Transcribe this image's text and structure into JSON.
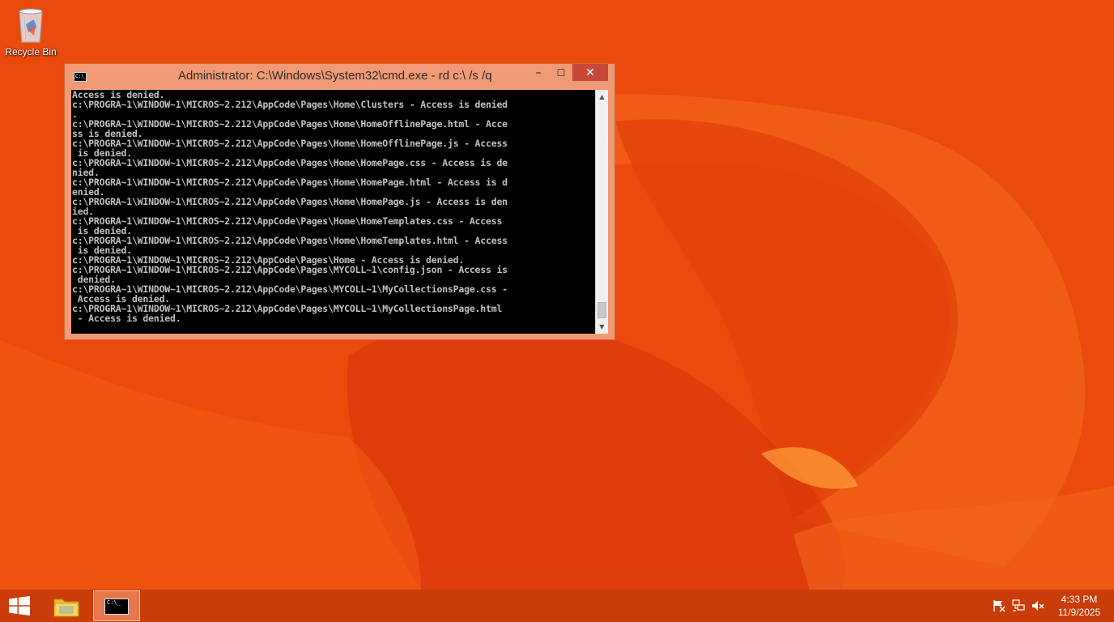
{
  "desktop": {
    "icons": [
      {
        "label": "Recycle Bin",
        "icon": "recycle-bin-icon"
      }
    ]
  },
  "cmd_window": {
    "title": "Administrator: C:\\Windows\\System32\\cmd.exe - rd  c:\\ /s /q",
    "icon": "cmd-icon",
    "controls": {
      "minimize": "–",
      "maximize": "☐",
      "close": "✕"
    },
    "lines": [
      "Access is denied.",
      "c:\\PROGRA~1\\WINDOW~1\\MICROS~2.212\\AppCode\\Pages\\Home\\Clusters - Access is denied",
      ".",
      "c:\\PROGRA~1\\WINDOW~1\\MICROS~2.212\\AppCode\\Pages\\Home\\HomeOfflinePage.html - Acce",
      "ss is denied.",
      "c:\\PROGRA~1\\WINDOW~1\\MICROS~2.212\\AppCode\\Pages\\Home\\HomeOfflinePage.js - Access",
      " is denied.",
      "c:\\PROGRA~1\\WINDOW~1\\MICROS~2.212\\AppCode\\Pages\\Home\\HomePage.css - Access is de",
      "nied.",
      "c:\\PROGRA~1\\WINDOW~1\\MICROS~2.212\\AppCode\\Pages\\Home\\HomePage.html - Access is d",
      "enied.",
      "c:\\PROGRA~1\\WINDOW~1\\MICROS~2.212\\AppCode\\Pages\\Home\\HomePage.js - Access is den",
      "ied.",
      "c:\\PROGRA~1\\WINDOW~1\\MICROS~2.212\\AppCode\\Pages\\Home\\HomeTemplates.css - Access",
      " is denied.",
      "c:\\PROGRA~1\\WINDOW~1\\MICROS~2.212\\AppCode\\Pages\\Home\\HomeTemplates.html - Access",
      " is denied.",
      "c:\\PROGRA~1\\WINDOW~1\\MICROS~2.212\\AppCode\\Pages\\Home - Access is denied.",
      "c:\\PROGRA~1\\WINDOW~1\\MICROS~2.212\\AppCode\\Pages\\MYCOLL~1\\config.json - Access is",
      " denied.",
      "c:\\PROGRA~1\\WINDOW~1\\MICROS~2.212\\AppCode\\Pages\\MYCOLL~1\\MyCollectionsPage.css -",
      " Access is denied.",
      "c:\\PROGRA~1\\WINDOW~1\\MICROS~2.212\\AppCode\\Pages\\MYCOLL~1\\MyCollectionsPage.html",
      " - Access is denied."
    ]
  },
  "taskbar": {
    "start_icon": "windows-logo-icon",
    "pinned": [
      {
        "name": "file-explorer",
        "icon": "folder-icon"
      },
      {
        "name": "command-prompt",
        "icon": "cmd-icon",
        "active": true
      }
    ],
    "tray": [
      "action-center-flag-icon",
      "network-icon",
      "volume-muted-icon"
    ],
    "clock": {
      "time": "4:33 PM",
      "date": "11/9/2025"
    }
  },
  "colors": {
    "desktop_bg": "#ea4a0c",
    "window_frame": "#f19a76",
    "close_button": "#c7493a",
    "console_bg": "#000000",
    "console_text": "#c0c0c0",
    "taskbar": "#be3708"
  }
}
